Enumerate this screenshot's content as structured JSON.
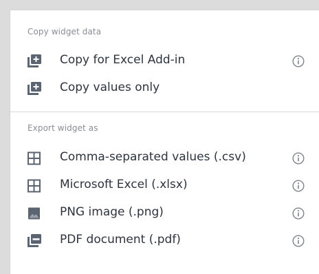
{
  "copy_section": {
    "heading": "Copy widget data",
    "items": [
      {
        "label": "Copy for Excel Add-in",
        "icon": "copy-plus-icon",
        "has_info": true
      },
      {
        "label": "Copy values only",
        "icon": "copy-plus-icon",
        "has_info": false
      }
    ]
  },
  "export_section": {
    "heading": "Export widget as",
    "items": [
      {
        "label": "Comma-separated values (.csv)",
        "icon": "table-grid-icon",
        "has_info": true
      },
      {
        "label": "Microsoft Excel (.xlsx)",
        "icon": "table-grid-icon",
        "has_info": true
      },
      {
        "label": "PNG image (.png)",
        "icon": "image-icon",
        "has_info": true
      },
      {
        "label": "PDF document (.pdf)",
        "icon": "pdf-file-icon",
        "has_info": true
      }
    ]
  },
  "colors": {
    "icon": "#5b6472",
    "text": "#2c3440",
    "heading": "#8a8d96",
    "info": "#7d838c"
  }
}
